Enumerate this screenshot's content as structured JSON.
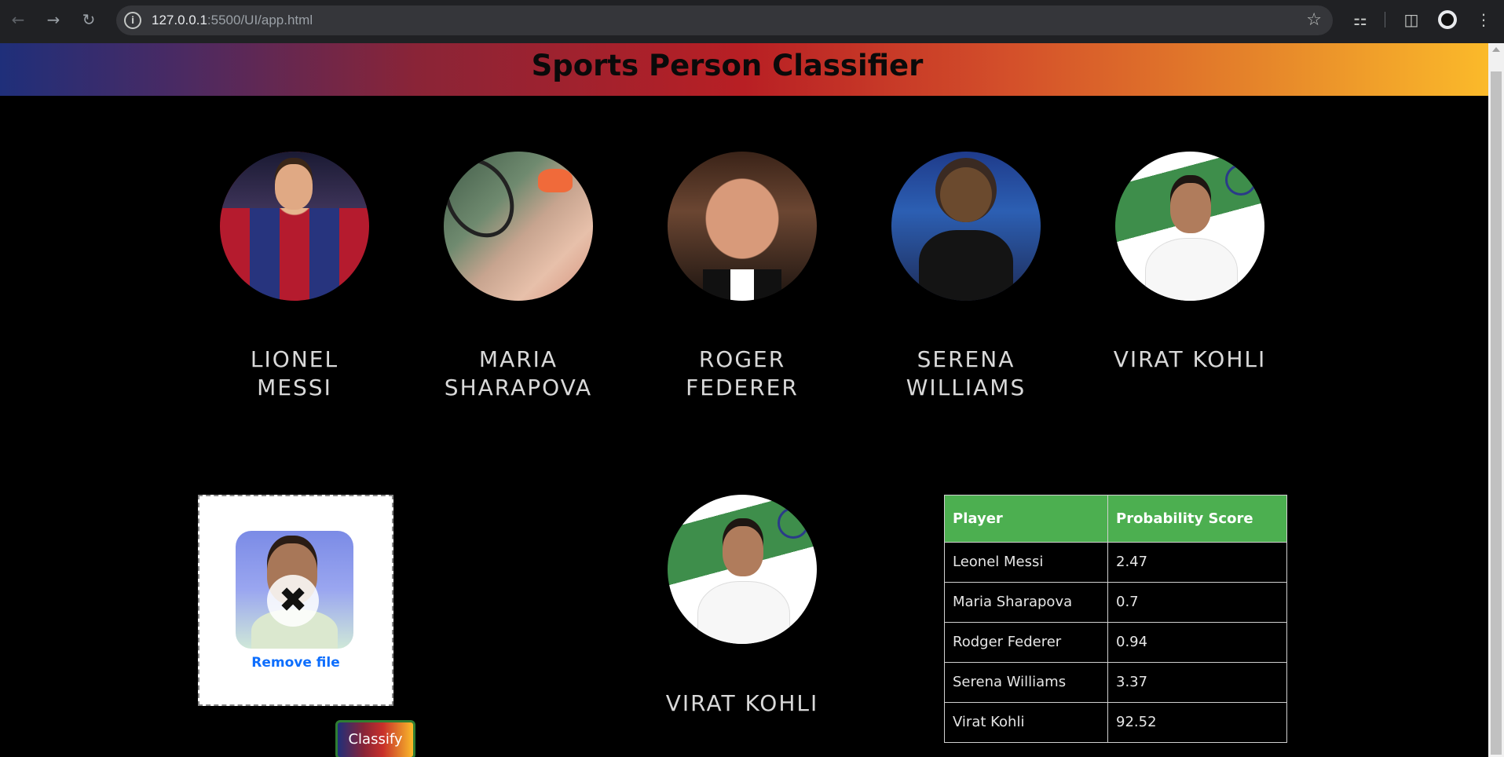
{
  "browser": {
    "url_host": "127.0.0.1",
    "url_rest": ":5500/UI/app.html"
  },
  "page": {
    "title": "Sports Person Classifier"
  },
  "players": [
    {
      "name": "LIONEL MESSI"
    },
    {
      "name": "MARIA SHARAPOVA"
    },
    {
      "name": "ROGER FEDERER"
    },
    {
      "name": "SERENA WILLIAMS"
    },
    {
      "name": "VIRAT KOHLI"
    }
  ],
  "upload": {
    "remove_label": "Remove file",
    "classify_label": "Classify"
  },
  "result": {
    "name": "VIRAT KOHLI"
  },
  "table": {
    "headers": [
      "Player",
      "Probability Score"
    ],
    "rows": [
      [
        "Leonel Messi",
        "2.47"
      ],
      [
        "Maria Sharapova",
        "0.7"
      ],
      [
        "Rodger Federer",
        "0.94"
      ],
      [
        "Serena Williams",
        "3.37"
      ],
      [
        "Virat Kohli",
        "92.52"
      ]
    ]
  },
  "colors": {
    "table_header": "#4caf50",
    "link": "#0d6efd",
    "button_border": "#2e7d32"
  }
}
